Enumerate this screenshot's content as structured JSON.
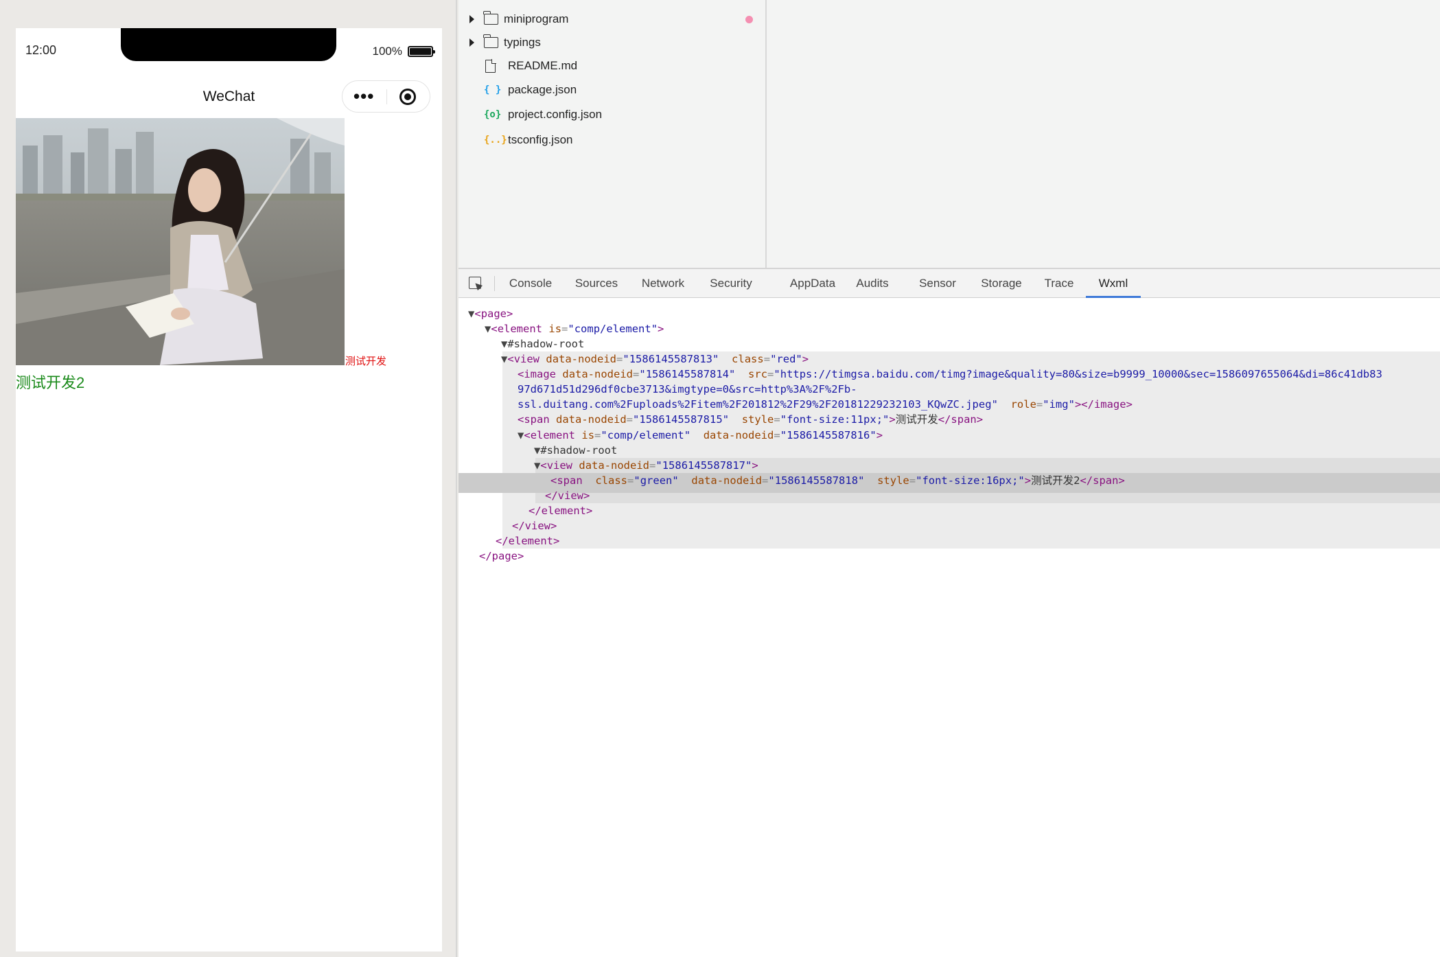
{
  "simulator": {
    "status_time": "12:00",
    "battery_percent": "100%",
    "battery_level": 1.0,
    "nav_title": "WeChat",
    "capsule_more": "•••",
    "red_text": "测试开发",
    "green_text": "测试开发2"
  },
  "file_tree": {
    "items": [
      {
        "label": "miniprogram",
        "kind": "folder",
        "icon": "folder-icon",
        "modified": true
      },
      {
        "label": "typings",
        "kind": "folder",
        "icon": "folder-icon"
      },
      {
        "label": "README.md",
        "kind": "file",
        "icon": "file-icon"
      },
      {
        "label": "package.json",
        "kind": "file",
        "icon": "json-icon",
        "icon_text": "{ }",
        "color": "#1e9ee8"
      },
      {
        "label": "project.config.json",
        "kind": "file",
        "icon": "config-json-icon",
        "icon_text": "{o}",
        "color": "#17a65a"
      },
      {
        "label": "tsconfig.json",
        "kind": "file",
        "icon": "ts-json-icon",
        "icon_text": "{..}",
        "color": "#e8a317"
      }
    ]
  },
  "devtools": {
    "tabs": [
      "Console",
      "Sources",
      "Network",
      "Security",
      "AppData",
      "Audits",
      "Sensor",
      "Storage",
      "Trace",
      "Wxml"
    ],
    "active_tab": "Wxml",
    "wxml": {
      "page_tag": "page",
      "element_tag": "element",
      "is_attr": "is",
      "comp_value": "comp/element",
      "shadow_root": "#shadow-root",
      "view_tag": "view",
      "image_tag": "image",
      "span_tag": "span",
      "nodeid_attr": "data-nodeid",
      "class_attr": "class",
      "src_attr": "src",
      "role_attr": "role",
      "style_attr": "style",
      "view1_nodeid": "1586145587813",
      "view1_class": "red",
      "image_nodeid": "1586145587814",
      "image_src_line1": "https://timgsa.baidu.com/timg?image&quality=80&size=b9999_10000&sec=1586097655064&di=86c41db83",
      "image_src_line2": "97d671d51d296df0cbe3713&imgtype=0&src=http%3A%2F%2Fb-",
      "image_src_line3": "ssl.duitang.com%2Fuploads%2Fitem%2F201812%2F29%2F20181229232103_KQwZC.jpeg",
      "image_role": "img",
      "span1_nodeid": "1586145587815",
      "span1_style": "font-size:11px;",
      "span1_text": "测试开发",
      "element2_nodeid": "1586145587816",
      "view2_nodeid": "1586145587817",
      "span2_class": "green",
      "span2_nodeid": "1586145587818",
      "span2_style": "font-size:16px;",
      "span2_text": "测试开发2"
    }
  }
}
